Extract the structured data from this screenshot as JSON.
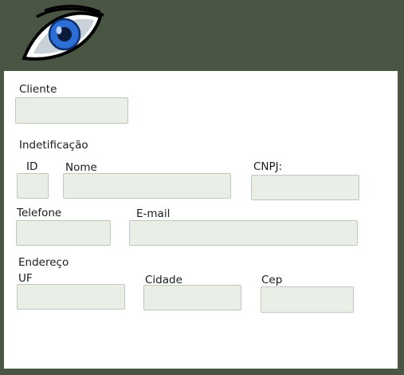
{
  "brand": {
    "logo_icon": "eye-icon"
  },
  "colors": {
    "background": "#4a5643",
    "panel": "#ffffff",
    "field_bg": "#e9efe7",
    "field_border": "#bfc9bc",
    "iris": "#2b6fd6"
  },
  "form": {
    "cliente": {
      "label": "Cliente",
      "value": "",
      "placeholder": ""
    },
    "identificacao": {
      "heading": "Indetificação",
      "id": {
        "label": "ID",
        "value": "",
        "placeholder": ""
      },
      "nome": {
        "label": "Nome",
        "value": "",
        "placeholder": ""
      },
      "cnpj": {
        "label": "CNPJ:",
        "value": "",
        "placeholder": ""
      }
    },
    "telefone": {
      "label": "Telefone",
      "value": "",
      "placeholder": ""
    },
    "email": {
      "label": "E-mail",
      "value": "",
      "placeholder": ""
    },
    "endereco": {
      "heading": "Endereço",
      "uf": {
        "label": "UF",
        "value": "",
        "placeholder": ""
      },
      "cidade": {
        "label": "Cidade",
        "value": "",
        "placeholder": ""
      },
      "cep": {
        "label": "Cep",
        "value": "",
        "placeholder": ""
      }
    }
  }
}
